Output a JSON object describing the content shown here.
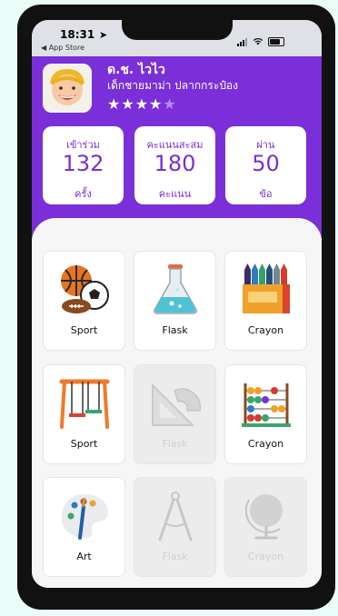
{
  "status_bar": {
    "time": "18:31",
    "back_label": "◀ App Store"
  },
  "profile": {
    "name": "ด.ช. ไวไว",
    "subtitle": "เด็กชายมาม่า ปลากกระป๋อง",
    "stars": [
      "★",
      "★",
      "★",
      "★",
      "★"
    ],
    "rating": 4,
    "max_rating": 5
  },
  "stats": [
    {
      "label": "เข้าร่วม",
      "value": "132",
      "unit": "ครั้ง"
    },
    {
      "label": "คะแนนสะสม",
      "value": "180",
      "unit": "คะแนน"
    },
    {
      "label": "ผ่าน",
      "value": "50",
      "unit": "ข้อ"
    }
  ],
  "tiles": [
    {
      "label": "Sport",
      "icon": "sport-balls-icon",
      "enabled": true
    },
    {
      "label": "Flask",
      "icon": "flask-icon",
      "enabled": true
    },
    {
      "label": "Crayon",
      "icon": "crayon-box-icon",
      "enabled": true
    },
    {
      "label": "Sport",
      "icon": "swing-icon",
      "enabled": true
    },
    {
      "label": "Flask",
      "icon": "set-square-icon",
      "enabled": false
    },
    {
      "label": "Crayon",
      "icon": "abacus-icon",
      "enabled": true
    },
    {
      "label": "Art",
      "icon": "art-palette-icon",
      "enabled": true
    },
    {
      "label": "Flask",
      "icon": "compass-icon",
      "enabled": false
    },
    {
      "label": "Crayon",
      "icon": "globe-icon",
      "enabled": false
    }
  ],
  "colors": {
    "primary": "#7a2fd9",
    "background": "#eafcf8"
  }
}
